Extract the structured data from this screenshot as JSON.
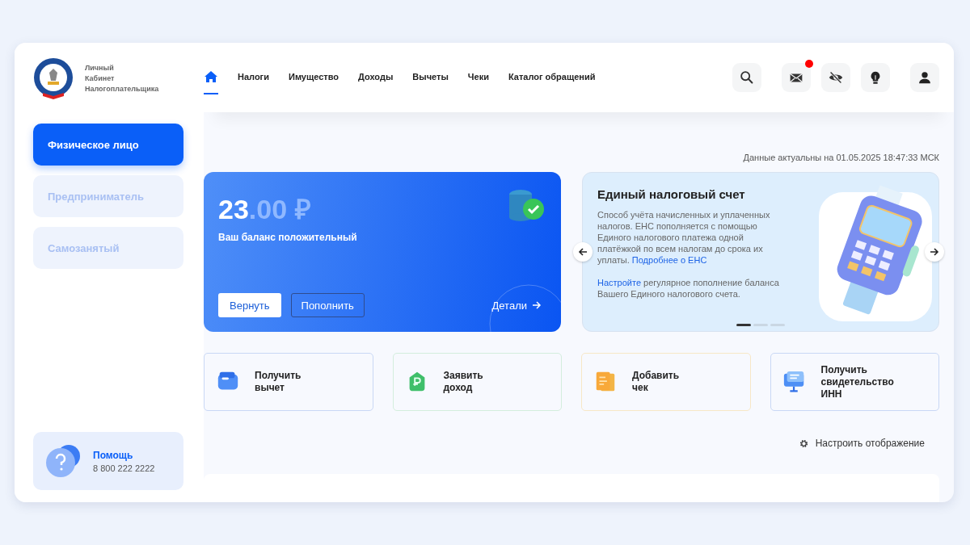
{
  "logo": {
    "lines": [
      "Личный",
      "Кабинет",
      "Налогоплательщика"
    ]
  },
  "profiles": [
    {
      "label": "Физическое лицо",
      "selected": true
    },
    {
      "label": "Предприниматель",
      "selected": false
    },
    {
      "label": "Самозанятый",
      "selected": false
    }
  ],
  "help": {
    "title": "Помощь",
    "phone": "8 800 222 2222"
  },
  "nav": [
    {
      "kind": "home",
      "selected": true
    },
    {
      "kind": "text",
      "label": "Налоги",
      "selected": false
    },
    {
      "kind": "text",
      "label": "Имущество",
      "selected": false
    },
    {
      "kind": "text",
      "label": "Доходы",
      "selected": false
    },
    {
      "kind": "text",
      "label": "Вычеты",
      "selected": false
    },
    {
      "kind": "text",
      "label": "Чеки",
      "selected": false
    },
    {
      "kind": "text",
      "label": "Каталог обращений",
      "selected": false
    }
  ],
  "header_icons": [
    {
      "kind": "search",
      "badge": false
    },
    {
      "kind": "mail",
      "badge": true
    },
    {
      "kind": "eye-off",
      "badge": false
    },
    {
      "kind": "bulb",
      "badge": false
    },
    {
      "kind": "user",
      "badge": false
    }
  ],
  "updated": "Данные актуальны на 01.05.2025 18:47:33 МСК",
  "balance": {
    "amount_int": "23",
    "amount_frac": ".00 ₽",
    "caption": "Ваш баланс положительный",
    "buttons": [
      "Вернуть",
      "Пополнить"
    ],
    "details": "Детали"
  },
  "promo": {
    "title": "Единый налоговый счет",
    "text": "Способ учёта начисленных и уплаченных налогов. ЕНС пополняется с помощью Единого налогового платежа одной платёжкой по всем налогам до срока их уплаты.",
    "link": "Подробнее о ЕНС",
    "link2": "Настройте",
    "text2": "регулярное пополнение баланса Вашего Единого налогового счета.",
    "slides": [
      {
        "selected": true
      },
      {
        "selected": false
      },
      {
        "selected": false
      }
    ]
  },
  "actions": [
    {
      "kind": "wallet",
      "label": "Получить вычет",
      "color": "#c9d8f5"
    },
    {
      "kind": "income",
      "label": "Заявить доход",
      "color": "#d3eedd"
    },
    {
      "kind": "receipt",
      "label": "Добавить чек",
      "color": "#f7e7c6"
    },
    {
      "kind": "certificate",
      "label": "Получить свидетельство ИНН",
      "color": "#c9d8f5"
    }
  ],
  "settings": "Настроить отображение"
}
